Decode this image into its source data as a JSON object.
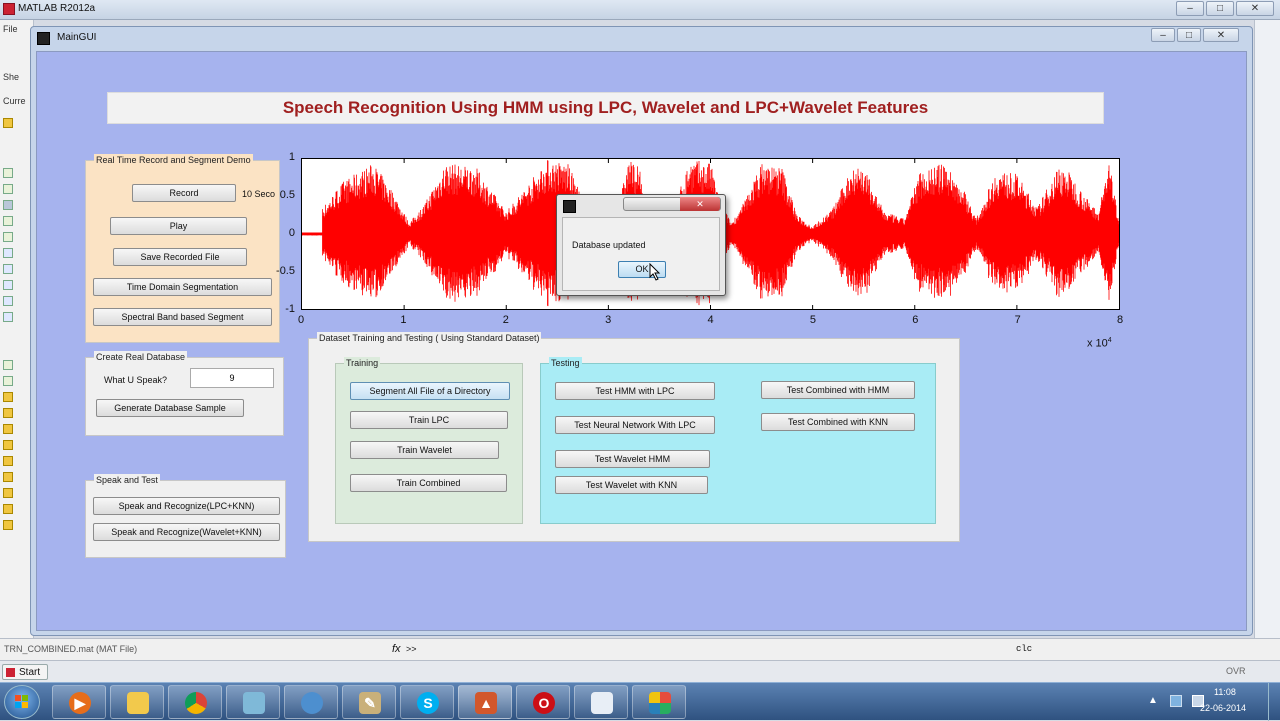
{
  "matlab": {
    "title": "MATLAB  R2012a",
    "menu_file": "File",
    "shortcuts": "She",
    "current": "Curre",
    "file_status": "TRN_COMBINED.mat (MAT File)",
    "command_prompt": ">>",
    "history_item": "clc",
    "start_label": "Start",
    "ovr_label": "OVR",
    "fx": "fx"
  },
  "window": {
    "title": "MainGUI",
    "heading": "Speech Recognition Using HMM using LPC, Wavelet and LPC+Wavelet Features"
  },
  "panel_record": {
    "title": "Real Time Record and Segment Demo",
    "record": "Record",
    "seconds": "10 Seco",
    "play": "Play",
    "save": "Save Recorded File",
    "time_domain": "Time Domain Segmentation",
    "spectral": "Spectral Band based Segment"
  },
  "panel_database": {
    "title": "Create Real Database",
    "prompt": "What U Speak?",
    "value": "9",
    "generate": "Generate Database Sample"
  },
  "panel_speak": {
    "title": "Speak and Test",
    "lpc_knn": "Speak and Recognize(LPC+KNN)",
    "wavelet_knn": "Speak and Recognize(Wavelet+KNN)"
  },
  "panel_dataset": {
    "title": "Dataset Training and Testing ( Using Standard Dataset)",
    "training": {
      "title": "Training",
      "segment": "Segment All File of a Directory",
      "lpc": "Train LPC",
      "wavelet": "Train Wavelet",
      "combined": "Train Combined"
    },
    "testing": {
      "title": "Testing",
      "hmm_lpc": "Test HMM with LPC",
      "nn_lpc": "Test Neural Network With LPC",
      "wavelet_hmm": "Test Wavelet HMM",
      "wavelet_knn": "Test Wavelet with KNN",
      "combined_hmm": "Test Combined with HMM",
      "combined_knn": "Test Combined with KNN"
    }
  },
  "plot": {
    "yticks": [
      "1",
      "0.5",
      "0",
      "-0.5",
      "-1"
    ],
    "xticks": [
      "0",
      "1",
      "2",
      "3",
      "4",
      "5",
      "6",
      "7",
      "8"
    ],
    "xscale": "x 10",
    "xscale_exp": "4",
    "signal_color": "#ff0000"
  },
  "chart_data": {
    "type": "line",
    "title": "",
    "xlabel": "",
    "ylabel": "",
    "xlim": [
      0,
      80000
    ],
    "ylim": [
      -1,
      1
    ],
    "series": [
      {
        "color": "#ff0000",
        "envelope": {
          "x": [
            0,
            2000,
            4000,
            7000,
            9000,
            10500,
            12000,
            14000,
            17000,
            20000,
            22000,
            24000,
            26000,
            28000,
            29800,
            31000,
            32000,
            33000,
            34000,
            35000,
            36000,
            38000,
            40000,
            41000,
            42000,
            43000,
            45000,
            47000,
            48500,
            50000,
            52000,
            54000,
            55000,
            57000,
            59000,
            60500,
            63000,
            65000,
            66000,
            68000,
            70000,
            72000,
            74000,
            75000,
            77000,
            78000,
            79000,
            80000
          ],
          "amplitude": [
            0.05,
            0.35,
            0.7,
            0.95,
            0.55,
            0.15,
            0.4,
            0.95,
            0.9,
            0.3,
            0.65,
            1.0,
            0.95,
            0.35,
            0.1,
            0.4,
            1.0,
            0.9,
            0.2,
            0.1,
            0.2,
            1.0,
            0.95,
            0.45,
            0.15,
            0.35,
            0.95,
            0.9,
            0.25,
            0.1,
            0.35,
            0.95,
            0.9,
            0.3,
            0.2,
            0.85,
            0.95,
            0.55,
            0.2,
            0.85,
            0.8,
            0.35,
            0.9,
            0.85,
            0.45,
            0.3,
            1.0,
            0.2
          ]
        }
      }
    ]
  },
  "dialog": {
    "message": "Database updated",
    "ok": "OK"
  },
  "clock": {
    "time": "11:08",
    "date": "22-06-2014"
  }
}
